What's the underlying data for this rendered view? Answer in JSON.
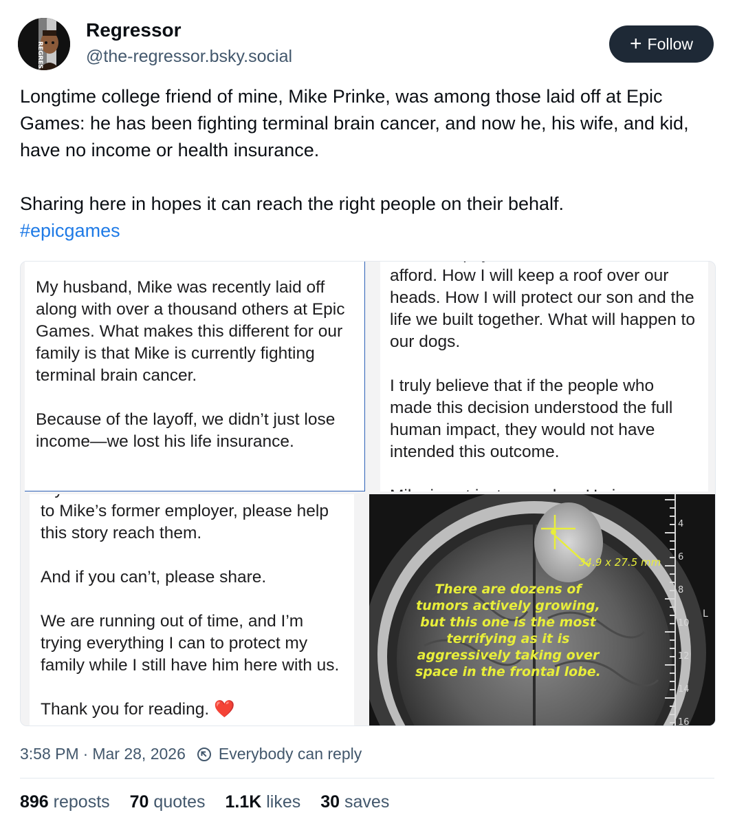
{
  "author": {
    "name": "Regressor",
    "handle": "@the-regressor.bsky.social",
    "avatar_text": "REGRES"
  },
  "follow_button": {
    "label": "Follow",
    "icon": "plus-icon"
  },
  "post": {
    "paragraph1": "Longtime college friend of mine, Mike Prinke, was among those laid off at Epic Games: he has been fighting terminal brain cancer, and now he, his wife, and kid, have no income or health insurance.",
    "paragraph2": "Sharing here in hopes it can reach the right people on their behalf.",
    "hashtag": "#epicgames"
  },
  "images": {
    "tile1": {
      "para1": "My husband, Mike was recently laid off along with over a thousand others at Epic Games. What makes this different for our family is that Mike is currently fighting terminal brain cancer.",
      "para2": "Because of the layoff, we didn’t just lose income—we lost his life insurance."
    },
    "tile2": {
      "para1": "how I will pay for treatment we can afford. How I will keep a roof over our heads. How I will protect our son and the life we built together. What will happen to our dogs.",
      "para2": "I truly believe that if the people who made this decision understood the full human impact, they would not have intended this outcome.",
      "para3": "Mike is not just a number. He is a"
    },
    "tile3": {
      "para1": "If you know or are someone connected to Mike’s former employer, please help this story reach them.",
      "para2": "And if you can’t, please share.",
      "para3": "We are running out of time, and I’m trying everything I can to protect my family while I still have him here with us.",
      "para4": "Thank you for reading. ❤️"
    },
    "tile4": {
      "measurement": "34.9 x 27.5 mm",
      "caption_lines": [
        "There are dozens of",
        "tumors actively growing,",
        "but this one is the most",
        "terrifying as it is",
        "aggressively taking over",
        "space in the frontal lobe."
      ],
      "scale_labels": [
        "4",
        "6",
        "8",
        "10",
        "12",
        "14",
        "16"
      ],
      "side_label": "L"
    }
  },
  "meta": {
    "time": "3:58 PM",
    "separator": "·",
    "date": "Mar 28, 2026",
    "reply_setting": "Everybody can reply"
  },
  "stats": {
    "reposts_count": "896",
    "reposts_label": "reposts",
    "quotes_count": "70",
    "quotes_label": "quotes",
    "likes_count": "1.1K",
    "likes_label": "likes",
    "saves_count": "30",
    "saves_label": "saves"
  },
  "colors": {
    "link": "#1e7ae6",
    "muted": "#42576c",
    "follow_bg": "#1e2936",
    "caption_yellow": "#e8ee3a"
  }
}
